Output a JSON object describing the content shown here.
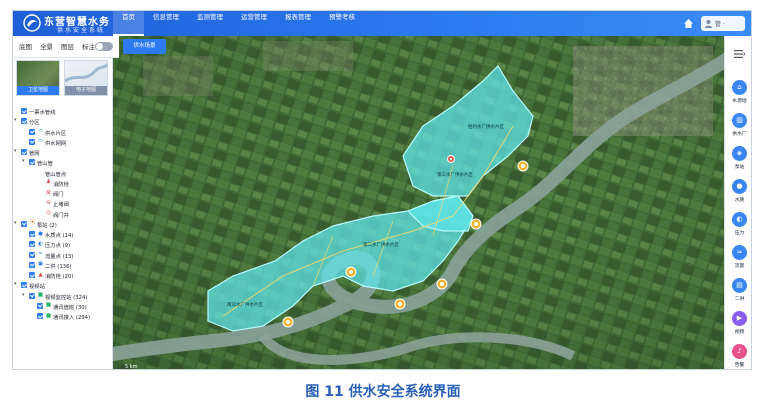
{
  "header": {
    "brand_title": "东营智慧水务",
    "brand_subtitle": "供水安全系统",
    "nav": [
      "首页",
      "信息管理",
      "监测管理",
      "运营管理",
      "报表管理",
      "预警考核"
    ],
    "active_nav": "首页",
    "user_name": "管 ·"
  },
  "controls": {
    "labels": [
      "底图",
      "全景",
      "图层",
      "标注"
    ],
    "mode_button": "供水场景"
  },
  "basemaps": [
    {
      "label": "卫星地图"
    },
    {
      "label": "电子地图"
    }
  ],
  "layer_tree": [
    {
      "level": 0,
      "caret": "",
      "check": true,
      "icon": "",
      "label": "一票水管线"
    },
    {
      "level": 0,
      "caret": "▾",
      "check": true,
      "icon": "",
      "label": "分区"
    },
    {
      "level": 1,
      "caret": "",
      "check": true,
      "icon": "area-icon",
      "label": "供水片区"
    },
    {
      "level": 1,
      "caret": "",
      "check": true,
      "icon": "area-icon",
      "label": "供水网网"
    },
    {
      "level": 0,
      "caret": "▾",
      "check": true,
      "icon": "",
      "label": "管网"
    },
    {
      "level": 1,
      "caret": "▾",
      "check": true,
      "icon": "",
      "label": "管山管"
    },
    {
      "level": 2,
      "caret": "",
      "check": false,
      "icon": "",
      "label": "管山管点"
    },
    {
      "level": 2,
      "caret": "",
      "check": false,
      "icon": "hydrant-icon",
      "label": "消防栓"
    },
    {
      "level": 2,
      "caret": "",
      "check": false,
      "icon": "valve-icon",
      "label": "阀门"
    },
    {
      "level": 2,
      "caret": "",
      "check": false,
      "icon": "pipe-cap-icon",
      "label": "止堵阀"
    },
    {
      "level": 2,
      "caret": "",
      "check": false,
      "icon": "well-icon",
      "label": "阀门井"
    },
    {
      "level": 0,
      "caret": "▾",
      "check": true,
      "icon": "pin-icon",
      "label": "泵站 (2)"
    },
    {
      "level": 1,
      "caret": "",
      "check": true,
      "icon": "drop-icon",
      "label": "水质点 (14)"
    },
    {
      "level": 1,
      "caret": "",
      "check": true,
      "icon": "gauge-icon",
      "label": "压力点 (9)"
    },
    {
      "level": 1,
      "caret": "",
      "check": true,
      "icon": "flow-icon",
      "label": "流量点 (13)"
    },
    {
      "level": 1,
      "caret": "",
      "check": true,
      "icon": "tap-icon",
      "label": "二供 (136)"
    },
    {
      "level": 1,
      "caret": "",
      "check": true,
      "icon": "fire-icon",
      "label": "消防栓 (20)"
    },
    {
      "level": 0,
      "caret": "▾",
      "check": true,
      "icon": "",
      "label": "视频站"
    },
    {
      "level": 1,
      "caret": "▾",
      "check": true,
      "icon": "camera-icon",
      "label": "视频监控站 (324)"
    },
    {
      "level": 2,
      "caret": "",
      "check": true,
      "icon": "camera-icon",
      "label": "通讯值班 (30)"
    },
    {
      "level": 2,
      "caret": "",
      "check": true,
      "icon": "camera-icon",
      "label": "通讯接入 (294)"
    }
  ],
  "map": {
    "areas": [
      {
        "label": "南郊水厂供水片区"
      },
      {
        "label": "第二水厂供水片区"
      },
      {
        "label": "第三水厂供水片区"
      },
      {
        "label": "胜利水厂供水片区"
      }
    ],
    "scale_text": "5 km",
    "area_fill": "#5fe6ec",
    "area_stroke": "#b8fbff"
  },
  "rail": {
    "tools": [
      {
        "label": "水源地",
        "icon": "reservoir-icon",
        "color": "#3a86f0"
      },
      {
        "label": "供水厂",
        "icon": "factory-icon",
        "color": "#3a86f0"
      },
      {
        "label": "泵站",
        "icon": "pump-icon",
        "color": "#3a86f0"
      },
      {
        "label": "水质",
        "icon": "drop-icon",
        "color": "#3a86f0"
      },
      {
        "label": "压力",
        "icon": "gauge-icon",
        "color": "#3a86f0"
      },
      {
        "label": "流量",
        "icon": "flow-icon",
        "color": "#3a86f0"
      },
      {
        "label": "二供",
        "icon": "building-icon",
        "color": "#3a86f0"
      },
      {
        "label": "视频",
        "icon": "video-icon",
        "color": "#8a5cf0"
      },
      {
        "label": "告警",
        "icon": "alarm-icon",
        "color": "#e8508a"
      }
    ]
  },
  "caption": {
    "text": "图 11   供水安全系统界面"
  }
}
